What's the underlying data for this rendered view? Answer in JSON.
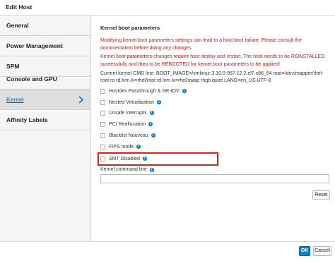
{
  "window": {
    "title": "Edit Host"
  },
  "sidebar": {
    "items": [
      {
        "label": "General"
      },
      {
        "label": "Power Management"
      },
      {
        "label": "SPM"
      },
      {
        "label": "Console and GPU"
      },
      {
        "label": "Kernel"
      },
      {
        "label": "Affinity Labels"
      }
    ],
    "active_index": 4
  },
  "kernel": {
    "section_title": "Kernel boot parameters",
    "warning_1": "Modifying kernel boot parameters settings can lead to a host boot failure. Please consult the documentation before doing any changes.",
    "warning_2": "Kernel boot parameters changes require host deploy and restart. The host needs to be REINSTALLED suceessfully and then to be REBOOTED for kernel boot parameters to be applied!",
    "current_cmdline": "Current kernel CMD line: BOOT_IMAGE=/vmlinuz-3.10.0-957.12.2.el7.x86_64 root=/dev/mapper/rhel-root ro rd.lvm.lv=rhel/root rd.lvm.lv=rhel/swap rhgb quiet LANG=en_US.UTF-8",
    "options": [
      {
        "label": "Hostdev Passthrough & SR-IOV",
        "checked": false
      },
      {
        "label": "Nested Virtualization",
        "checked": false
      },
      {
        "label": "Unsafe Interrupts",
        "checked": false
      },
      {
        "label": "PCI Reallocation",
        "checked": false
      },
      {
        "label": "Blacklist Nouveau",
        "checked": false
      },
      {
        "label": "FIPS mode",
        "checked": false
      },
      {
        "label": "SMT Disabled",
        "checked": false
      }
    ],
    "command_line_label": "Kernel command line",
    "command_line_value": "",
    "reset_label": "Reset"
  },
  "footer": {
    "ok_label": "OK",
    "cancel_label": "Cancel"
  },
  "colors": {
    "accent": "#0088ce",
    "warning": "#cc1a1a",
    "highlight": "#e0201b"
  },
  "icons": {
    "info": "info-circle-icon",
    "chevron": "chevron-right-icon"
  }
}
